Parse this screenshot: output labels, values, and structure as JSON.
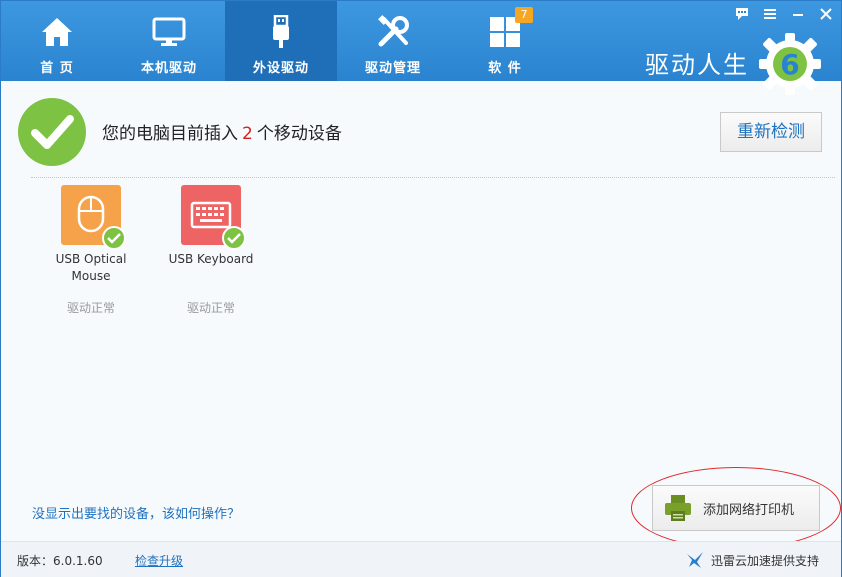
{
  "nav": {
    "items": [
      {
        "label": "首 页",
        "icon": "home-icon"
      },
      {
        "label": "本机驱动",
        "icon": "monitor-icon"
      },
      {
        "label": "外设驱动",
        "icon": "usb-icon",
        "active": true
      },
      {
        "label": "驱动管理",
        "icon": "tools-icon"
      },
      {
        "label": "软 件",
        "icon": "apps-grid-icon",
        "badge": "7"
      }
    ]
  },
  "brand": {
    "name": "驱动人生",
    "logo_char": "6"
  },
  "status": {
    "prefix": "您的电脑目前插入",
    "count": "2",
    "suffix": "个移动设备"
  },
  "rescan_label": "重新检测",
  "devices": [
    {
      "name_line1": "USB Optical",
      "name_line2": "Mouse",
      "status": "驱动正常",
      "color": "#f6a24a"
    },
    {
      "name_line1": "USB Keyboard",
      "name_line2": "",
      "status": "驱动正常",
      "color": "#ee6363"
    }
  ],
  "help_link": "没显示出要找的设备，该如何操作？",
  "printer_button": "添加网络打印机",
  "footer": {
    "version": "版本：6.0.1.60",
    "update_link": "检查升级",
    "support": "迅雷云加速提供支持"
  },
  "colors": {
    "header": "#2a83cf",
    "active_tab": "#1f6fb8",
    "check_green": "#7dc242",
    "badge": "#f5a623"
  }
}
